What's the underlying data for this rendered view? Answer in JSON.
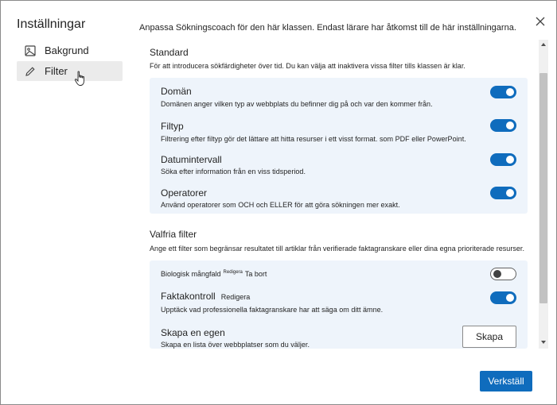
{
  "sidebar": {
    "title": "Inställningar",
    "items": [
      {
        "label": "Bakgrund",
        "icon": "image-icon"
      },
      {
        "label": "Filter",
        "icon": "pencil-icon",
        "active": true
      }
    ]
  },
  "header": {
    "description": "Anpassa Sökningscoach för den här klassen. Endast lärare har åtkomst till de här inställningarna."
  },
  "standard": {
    "title": "Standard",
    "description": "För att introducera sökfärdigheter över tid. Du kan välja att inaktivera vissa filter tills klassen är klar.",
    "items": [
      {
        "title": "Domän",
        "description": "Domänen anger vilken typ av webbplats du befinner dig på och var den kommer från.",
        "enabled": true
      },
      {
        "title": "Filtyp",
        "description": "Filtrering efter filtyp gör det lättare att hitta resurser i ett visst format. som PDF eller PowerPoint.",
        "enabled": true
      },
      {
        "title": "Datumintervall",
        "description": "Söka efter information från en viss tidsperiod.",
        "enabled": true
      },
      {
        "title": "Operatorer",
        "description": "Använd operatorer som OCH och ELLER för att göra sökningen mer exakt.",
        "enabled": true
      }
    ]
  },
  "optional": {
    "title": "Valfria filter",
    "description": "Ange ett filter som begränsar resultatet till artiklar från verifierade faktagranskare eller dina egna prioriterade resurser.",
    "diversity": {
      "title": "Biologisk mångfald",
      "edit": "Redigera",
      "remove": "Ta bort",
      "enabled": false
    },
    "factcheck": {
      "title": "Faktakontroll",
      "edit": "Redigera",
      "description": "Upptäck vad professionella faktagranskare har att säga om ditt ämne.",
      "enabled": true
    },
    "custom": {
      "title": "Skapa en egen",
      "description": "Skapa en lista över webbplatser som du väljer.",
      "button": "Skapa"
    }
  },
  "footer": {
    "apply": "Verkställ"
  },
  "colors": {
    "accent": "#0f6cbd",
    "panel": "#eef4fb"
  }
}
